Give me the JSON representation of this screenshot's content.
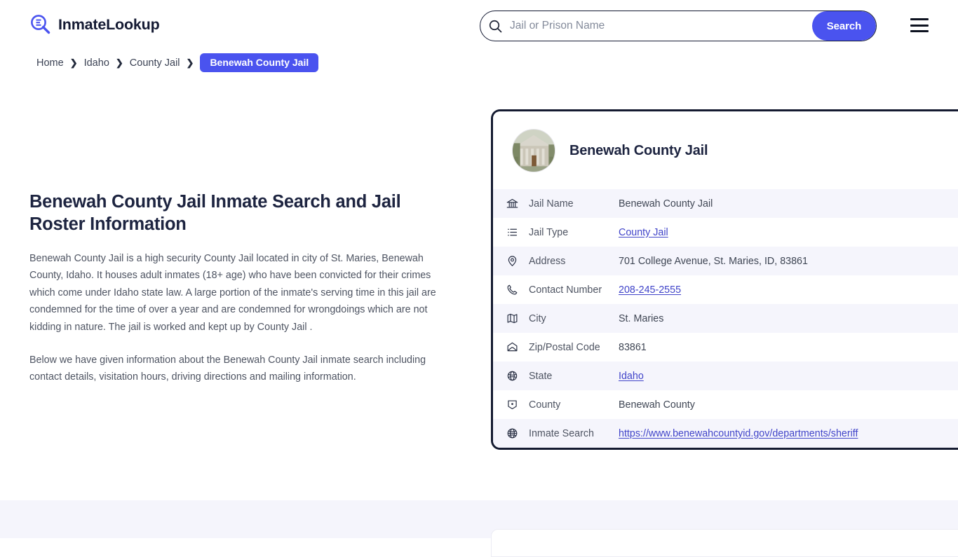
{
  "header": {
    "brand": "InmateLookup",
    "logo_icon": "search-list-logo-icon",
    "menu_icon": "hamburger-menu-icon"
  },
  "search": {
    "placeholder": "Jail or Prison Name",
    "value": "",
    "button_label": "Search",
    "icon": "search-icon",
    "accent_color": "#4a53ef"
  },
  "breadcrumb": {
    "items": [
      {
        "label": "Home"
      },
      {
        "label": "Idaho"
      },
      {
        "label": "County Jail"
      }
    ],
    "separator": "❯",
    "current": "Benewah County Jail"
  },
  "main": {
    "title": "Benewah County Jail Inmate Search and Jail Roster Information",
    "paragraphs": [
      "Benewah County Jail is a high security County Jail located in city of St. Maries, Benewah County, Idaho. It houses adult inmates (18+ age) who have been convicted for their crimes which come under Idaho state law. A large portion of the inmate's serving time in this jail are condemned for the time of over a year and are condemned for wrongdoings which are not kidding in nature. The jail is worked and kept up by County Jail .",
      "Below we have given information about the Benewah County Jail inmate search including contact details, visitation hours, driving directions and mailing information."
    ]
  },
  "card": {
    "title": "Benewah County Jail",
    "avatar_icon": "courthouse-photo",
    "border_color": "#141a30",
    "rows": [
      {
        "icon": "bank-icon",
        "label": "Jail Name",
        "value": "Benewah County Jail",
        "link": false
      },
      {
        "icon": "list-icon",
        "label": "Jail Type",
        "value": "County Jail",
        "link": true
      },
      {
        "icon": "map-pin-icon",
        "label": "Address",
        "value": "701 College Avenue, St. Maries, ID, 83861",
        "link": false
      },
      {
        "icon": "phone-icon",
        "label": "Contact Number",
        "value": "208-245-2555",
        "link": true
      },
      {
        "icon": "map-icon",
        "label": "City",
        "value": "St. Maries",
        "link": false
      },
      {
        "icon": "envelope-icon",
        "label": "Zip/Postal Code",
        "value": "83861",
        "link": false
      },
      {
        "icon": "globe-badge-icon",
        "label": "State",
        "value": "Idaho",
        "link": true
      },
      {
        "icon": "county-icon",
        "label": "County",
        "value": "Benewah County",
        "link": false
      },
      {
        "icon": "globe-icon",
        "label": "Inmate Search",
        "value": "https://www.benewahcountyid.gov/departments/sheriff",
        "link": true
      }
    ]
  }
}
